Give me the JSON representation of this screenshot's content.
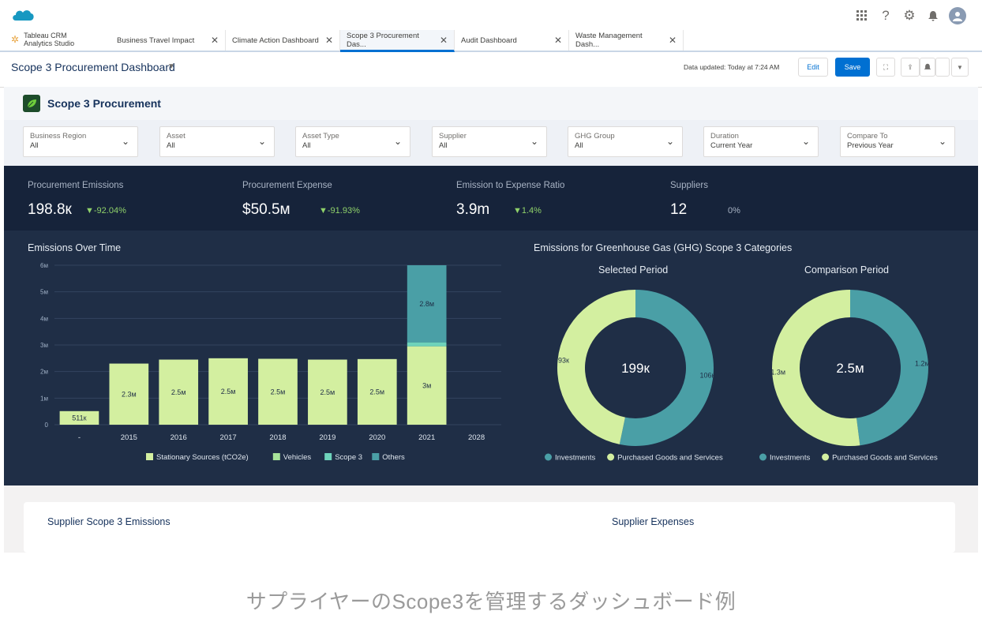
{
  "header": {
    "global_icons": [
      "app-launcher-icon",
      "help-icon",
      "setup-gear-icon",
      "notification-bell-icon",
      "user-avatar-icon"
    ]
  },
  "app": {
    "name_line1": "Tableau CRM",
    "name_line2": "Analytics Studio"
  },
  "tabs": [
    {
      "label": "Business Travel Impact",
      "active": false
    },
    {
      "label": "Climate Action Dashboard",
      "active": false
    },
    {
      "label": "Scope 3 Procurement Das...",
      "active": true
    },
    {
      "label": "Audit Dashboard",
      "active": false
    },
    {
      "label": "Waste Management Dash...",
      "active": false
    }
  ],
  "dashboard": {
    "title": "Scope 3 Procurement Dashboard",
    "updated": "Data updated: Today at 7:24 AM",
    "edit_label": "Edit",
    "save_label": "Save"
  },
  "section": {
    "title": "Scope 3 Procurement"
  },
  "filters": [
    {
      "label": "Business Region",
      "value": "All"
    },
    {
      "label": "Asset",
      "value": "All"
    },
    {
      "label": "Asset Type",
      "value": "All"
    },
    {
      "label": "Supplier",
      "value": "All"
    },
    {
      "label": "GHG Group",
      "value": "All"
    },
    {
      "label": "Duration",
      "value": "Current Year"
    },
    {
      "label": "Compare To",
      "value": "Previous Year"
    }
  ],
  "kpis": [
    {
      "label": "Procurement Emissions",
      "value": "198.8к",
      "delta": "▼-92.04%"
    },
    {
      "label": "Procurement Expense",
      "value": "$50.5м",
      "delta": "▼-91.93%"
    },
    {
      "label": "Emission to Expense Ratio",
      "value": "3.9m",
      "delta": "▼1.4%"
    },
    {
      "label": "Suppliers",
      "value": "12",
      "delta": "0%"
    }
  ],
  "emissions_over_time": {
    "title": "Emissions Over Time"
  },
  "ghg": {
    "title": "Emissions for Greenhouse Gas (GHG) Scope 3 Categories",
    "selected_title": "Selected Period",
    "comparison_title": "Comparison Period"
  },
  "chart_data": [
    {
      "type": "bar",
      "title": "Emissions Over Time",
      "categories": [
        "-",
        "2015",
        "2016",
        "2017",
        "2018",
        "2019",
        "2020",
        "2021",
        "2028"
      ],
      "series": [
        {
          "name": "Stationary Sources (tCO2e)",
          "values": [
            0.511,
            2.3,
            2.45,
            2.5,
            2.48,
            2.45,
            2.47,
            2.95,
            0
          ]
        },
        {
          "name": "Vehicles",
          "values": [
            0,
            0,
            0,
            0,
            0,
            0,
            0,
            0,
            0
          ]
        },
        {
          "name": "Scope 3",
          "values": [
            0,
            0,
            0,
            0,
            0,
            0,
            0,
            0.15,
            0
          ]
        },
        {
          "name": "Others",
          "values": [
            0,
            0,
            0,
            0,
            0,
            0,
            0,
            2.9,
            0
          ]
        }
      ],
      "data_labels": [
        "511к",
        "2.3м",
        "2.5м",
        "2.5м",
        "2.5м",
        "2.5м",
        "2.5м",
        "3м",
        ""
      ],
      "others_label_2021": "2.8м",
      "y_ticks": [
        "0",
        "1м",
        "2м",
        "3м",
        "4м",
        "5м",
        "6м"
      ],
      "ylim": [
        0,
        6
      ],
      "unit": "millions",
      "legend_position": "bottom",
      "colors": [
        "#d3efa0",
        "#a7e39a",
        "#6ed3bb",
        "#4a9fa6"
      ]
    },
    {
      "type": "pie",
      "title": "Selected Period",
      "center_label": "199к",
      "slices": [
        {
          "name": "Investments",
          "value": 106,
          "label": "106к"
        },
        {
          "name": "Purchased Goods and Services",
          "value": 93,
          "label": "93к"
        }
      ],
      "colors": [
        "#4a9fa6",
        "#d3efa0"
      ],
      "legend_position": "bottom"
    },
    {
      "type": "pie",
      "title": "Comparison Period",
      "center_label": "2.5м",
      "slices": [
        {
          "name": "Investments",
          "value": 1.2,
          "label": "1.2м"
        },
        {
          "name": "Purchased Goods and Services",
          "value": 1.3,
          "label": "1.3м"
        }
      ],
      "colors": [
        "#4a9fa6",
        "#d3efa0"
      ],
      "legend_position": "bottom"
    }
  ],
  "bottom": {
    "left_title": "Supplier Scope 3 Emissions",
    "right_title": "Supplier Expenses"
  },
  "caption": "サプライヤーのScope3を管理するダッシュボード例"
}
